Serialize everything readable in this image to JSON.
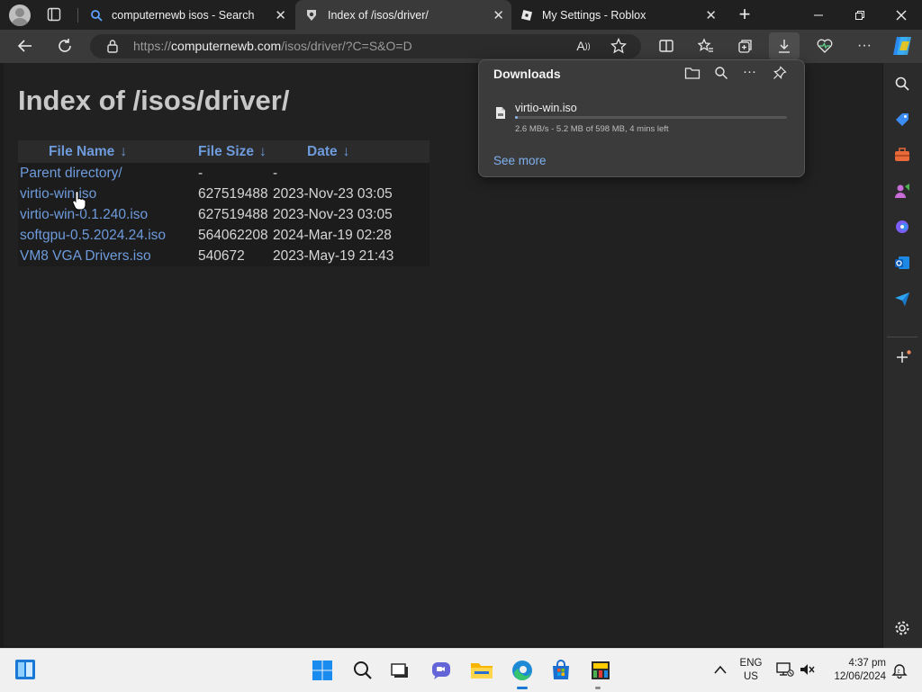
{
  "browser": {
    "tabs": [
      {
        "title": "computernewb isos - Search",
        "icon": "search-icon"
      },
      {
        "title": "Index of /isos/driver/",
        "icon": "site-icon",
        "active": true
      },
      {
        "title": "My Settings - Roblox",
        "icon": "roblox-icon"
      }
    ],
    "new_tab": "+",
    "url_host": "computernewb.com",
    "url_scheme": "https://",
    "url_path": "/isos/driver/?C=S&O=D"
  },
  "page": {
    "heading": "Index of /isos/driver/",
    "columns": [
      "File Name",
      "File Size",
      "Date"
    ],
    "sort_arrow": "↓",
    "rows": [
      {
        "name": "Parent directory/",
        "size": "-",
        "date": "-"
      },
      {
        "name": "virtio-win.iso",
        "size": "627519488",
        "date": "2023-Nov-23 03:05"
      },
      {
        "name": "virtio-win-0.1.240.iso",
        "size": "627519488",
        "date": "2023-Nov-23 03:05"
      },
      {
        "name": "softgpu-0.5.2024.24.iso",
        "size": "564062208",
        "date": "2024-Mar-19 02:28"
      },
      {
        "name": "VM8 VGA Drivers.iso",
        "size": "540672",
        "date": "2023-May-19 21:43"
      }
    ]
  },
  "downloads": {
    "title": "Downloads",
    "file": "virtio-win.iso",
    "status": "2.6 MB/s - 5.2 MB of 598 MB, 4 mins left",
    "progress": 0.009,
    "see_more": "See more"
  },
  "taskbar": {
    "lang_line1": "ENG",
    "lang_line2": "US",
    "time": "4:37 pm",
    "date": "12/06/2024"
  },
  "colors": {
    "accent": "#6e9bdc",
    "link": "#7eb0f0"
  }
}
